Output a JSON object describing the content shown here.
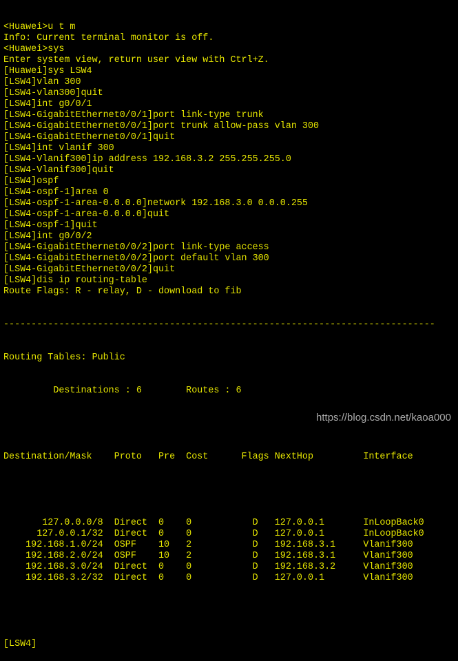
{
  "terminal": {
    "text_color": "#e6e600",
    "background_color": "#000000",
    "session_lines": [
      "<Huawei>u t m",
      "Info: Current terminal monitor is off.",
      "<Huawei>sys",
      "Enter system view, return user view with Ctrl+Z.",
      "[Huawei]sys LSW4",
      "[LSW4]vlan 300",
      "[LSW4-vlan300]quit",
      "[LSW4]int g0/0/1",
      "[LSW4-GigabitEthernet0/0/1]port link-type trunk",
      "[LSW4-GigabitEthernet0/0/1]port trunk allow-pass vlan 300",
      "[LSW4-GigabitEthernet0/0/1]quit",
      "[LSW4]int vlanif 300",
      "[LSW4-Vlanif300]ip address 192.168.3.2 255.255.255.0",
      "[LSW4-Vlanif300]quit",
      "[LSW4]ospf",
      "[LSW4-ospf-1]area 0",
      "[LSW4-ospf-1-area-0.0.0.0]network 192.168.3.0 0.0.0.255",
      "[LSW4-ospf-1-area-0.0.0.0]quit",
      "[LSW4-ospf-1]quit",
      "[LSW4]int g0/0/2",
      "[LSW4-GigabitEthernet0/0/2]port link-type access",
      "[LSW4-GigabitEthernet0/0/2]port default vlan 300",
      "[LSW4-GigabitEthernet0/0/2]quit",
      "[LSW4]dis ip routing-table",
      "Route Flags: R - relay, D - download to fib"
    ],
    "separator": "------------------------------------------------------------------------------",
    "routing_tables_line": "Routing Tables: Public",
    "summary_line": "         Destinations : 6        Routes : 6",
    "table_header": "Destination/Mask    Proto   Pre  Cost      Flags NextHop         Interface",
    "routes": [
      {
        "destination": "127.0.0.0/8",
        "proto": "Direct",
        "pre": "0",
        "cost": "0",
        "flags": "D",
        "nexthop": "127.0.0.1",
        "interface": "InLoopBack0"
      },
      {
        "destination": "127.0.0.1/32",
        "proto": "Direct",
        "pre": "0",
        "cost": "0",
        "flags": "D",
        "nexthop": "127.0.0.1",
        "interface": "InLoopBack0"
      },
      {
        "destination": "192.168.1.0/24",
        "proto": "OSPF",
        "pre": "10",
        "cost": "2",
        "flags": "D",
        "nexthop": "192.168.3.1",
        "interface": "Vlanif300"
      },
      {
        "destination": "192.168.2.0/24",
        "proto": "OSPF",
        "pre": "10",
        "cost": "2",
        "flags": "D",
        "nexthop": "192.168.3.1",
        "interface": "Vlanif300"
      },
      {
        "destination": "192.168.3.0/24",
        "proto": "Direct",
        "pre": "0",
        "cost": "0",
        "flags": "D",
        "nexthop": "192.168.3.2",
        "interface": "Vlanif300"
      },
      {
        "destination": "192.168.3.2/32",
        "proto": "Direct",
        "pre": "0",
        "cost": "0",
        "flags": "D",
        "nexthop": "127.0.0.1",
        "interface": "Vlanif300"
      }
    ],
    "prompt": "[LSW4]"
  },
  "watermark": "https://blog.csdn.net/kaoa000"
}
